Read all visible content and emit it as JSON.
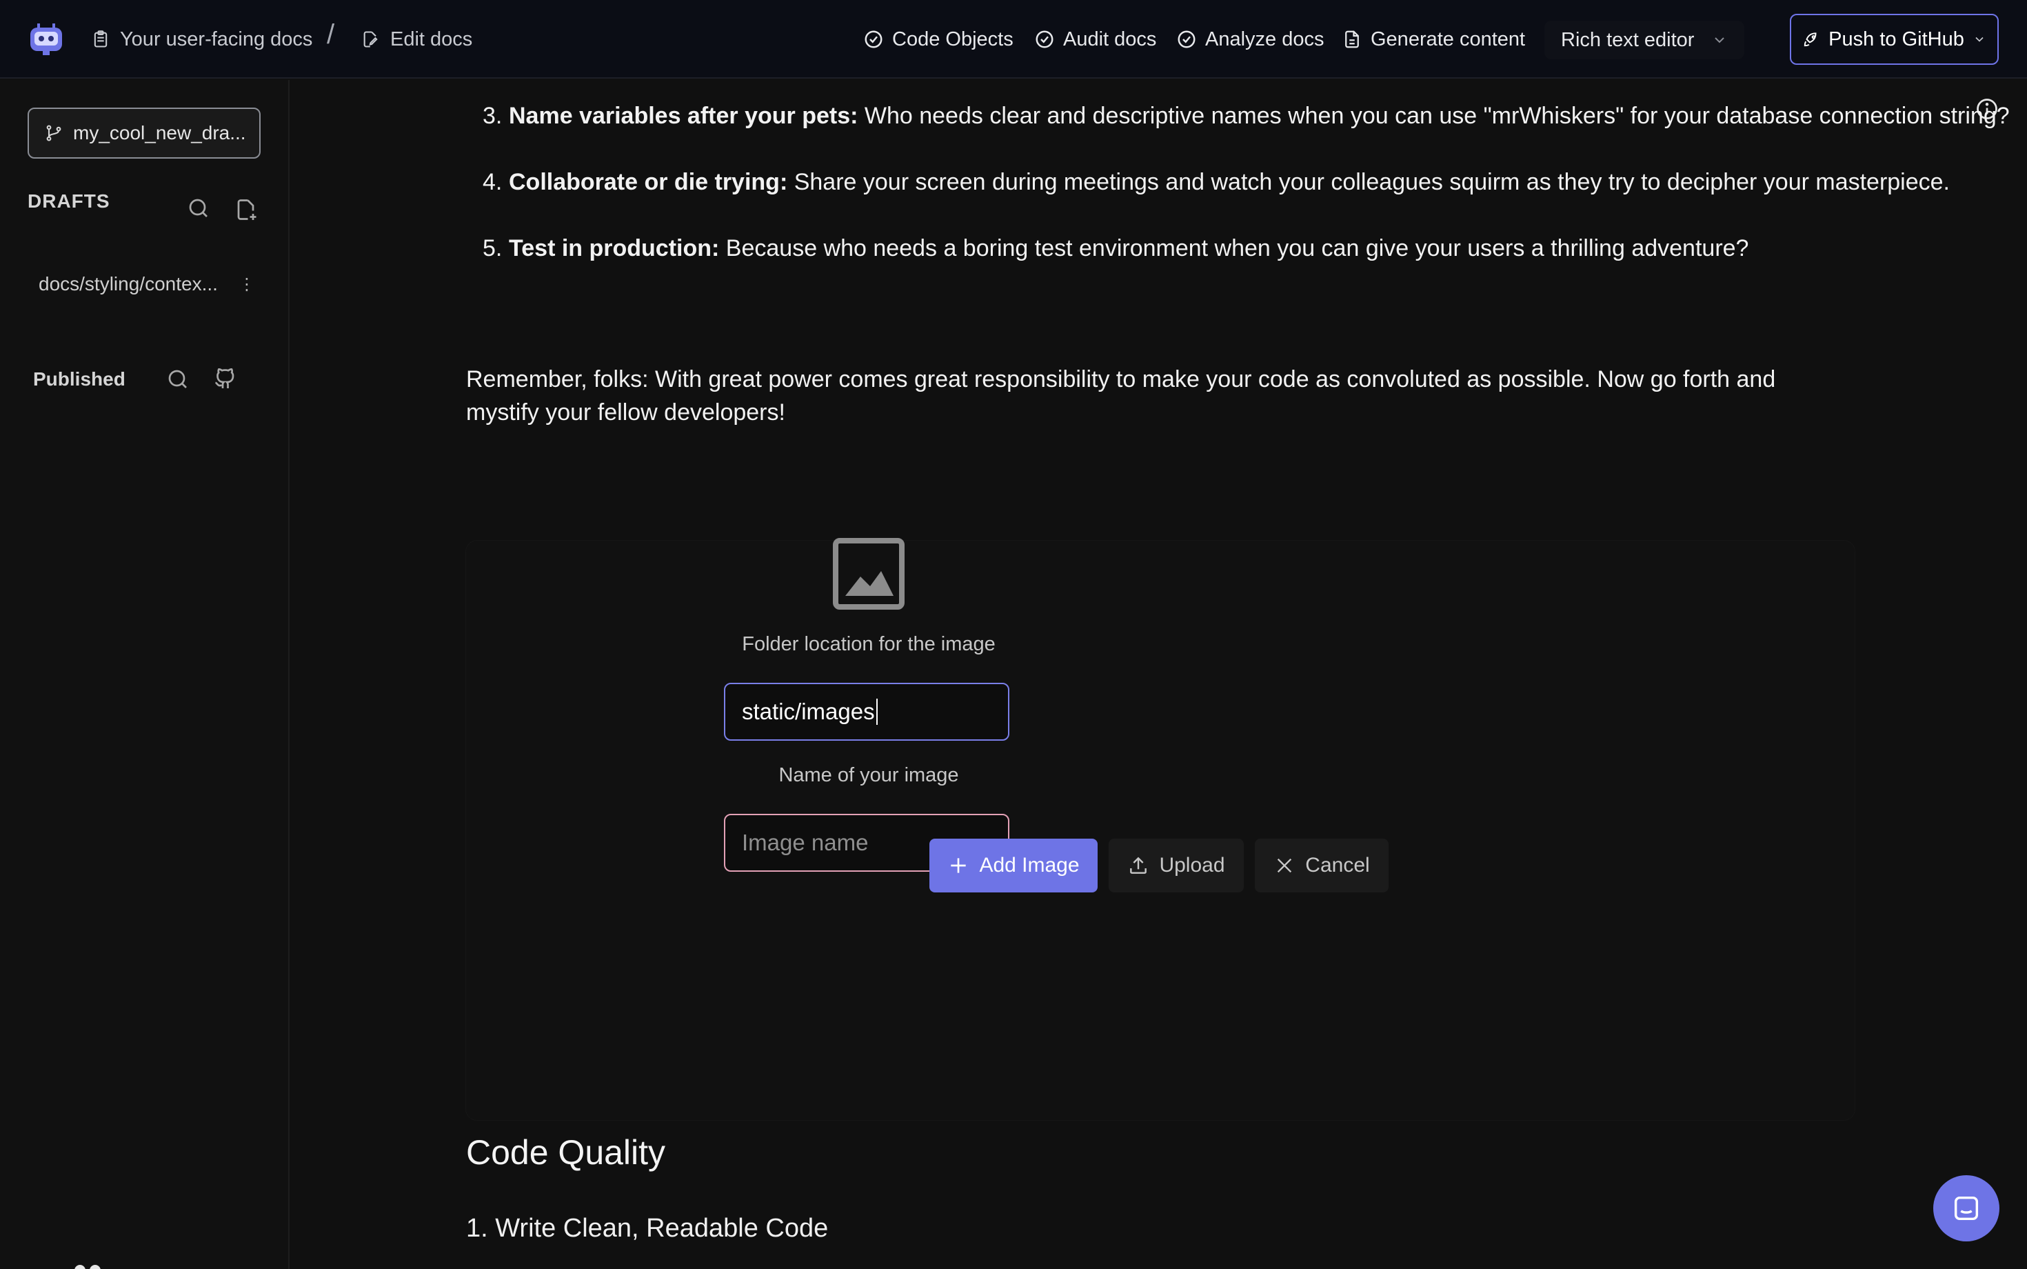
{
  "header": {
    "breadcrumb": {
      "root": "Your user-facing docs",
      "separator": "/",
      "current": "Edit docs"
    },
    "nav": [
      {
        "label": "Code Objects",
        "icon": "check-circle-icon"
      },
      {
        "label": "Audit docs",
        "icon": "check-circle-icon"
      },
      {
        "label": "Analyze docs",
        "icon": "check-circle-icon"
      },
      {
        "label": "Generate content",
        "icon": "document-icon"
      }
    ],
    "editor_mode": "Rich text editor",
    "push_label": "Push to GitHub"
  },
  "sidebar": {
    "branch": "my_cool_new_dra...",
    "drafts_label": "DRAFTS",
    "drafts": [
      {
        "path": "docs/styling/contex...",
        "menu": "⋮"
      }
    ],
    "published_label": "Published"
  },
  "content": {
    "list_items": [
      {
        "num": "3.",
        "bold": "Name variables after your pets:",
        "text": " Who needs clear and descriptive names when you can use \"mrWhiskers\" for your database connection string?"
      },
      {
        "num": "4.",
        "bold": "Collaborate or die trying:",
        "text": " Share your screen during meetings and watch your colleagues squirm as they try to decipher your masterpiece."
      },
      {
        "num": "5.",
        "bold": "Test in production:",
        "text": " Because who needs a boring test environment when you can give your users a thrilling adventure?"
      }
    ],
    "paragraph": "Remember, folks: With great power comes great responsibility to make your code as convoluted as possible. Now go forth and mystify your fellow developers!",
    "image_form": {
      "folder_label": "Folder location for the image",
      "folder_value": "static/images",
      "name_label": "Name of your image",
      "name_placeholder": "Image name",
      "add_label": "Add Image",
      "upload_label": "Upload",
      "cancel_label": "Cancel"
    },
    "heading": "Code Quality",
    "subheading": "1. Write Clean, Readable Code"
  },
  "colors": {
    "accent": "#6e74e6",
    "invalid_border": "#e3a1b6",
    "background": "#101010"
  }
}
